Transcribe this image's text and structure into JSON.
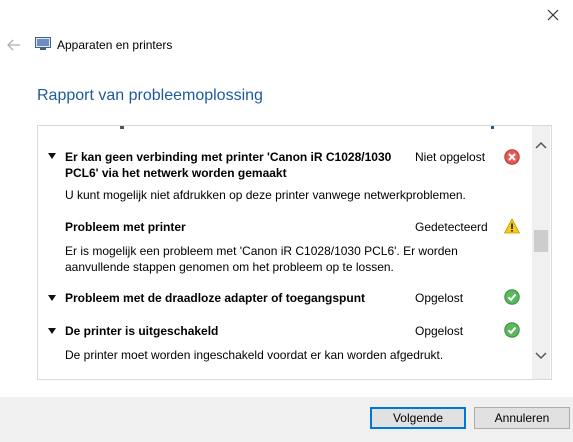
{
  "header": {
    "app_title": "Apparaten en printers",
    "heading": "Rapport van probleemoplossing"
  },
  "items": [
    {
      "title_line1": "Er kan geen verbinding met printer 'Canon iR C1028/1030",
      "title_line2": "PCL6' via het netwerk worden gemaakt",
      "status": "Niet opgelost",
      "icon": "error-icon",
      "detail": "U kunt mogelijk niet afdrukken op deze printer vanwege netwerkproblemen."
    },
    {
      "title": "Probleem met printer",
      "status": "Gedetecteerd",
      "icon": "warning-icon",
      "detail_line1": "Er is mogelijk een probleem met 'Canon iR C1028/1030 PCL6'. Er worden",
      "detail_line2": "aanvullende stappen genomen om het probleem op te lossen."
    },
    {
      "title": "Probleem met de draadloze adapter of toegangspunt",
      "status": "Opgelost",
      "icon": "success-icon"
    },
    {
      "title": "De printer is uitgeschakeld",
      "status": "Opgelost",
      "icon": "success-icon",
      "detail": "De printer moet worden ingeschakeld voordat er kan worden afgedrukt."
    }
  ],
  "buttons": {
    "next": "Volgende",
    "cancel": "Annuleren"
  },
  "colors": {
    "heading": "#1e5aa0",
    "error": "#d9534f",
    "warning": "#f5c400",
    "success": "#4caf50",
    "primary_border": "#0078d7"
  }
}
